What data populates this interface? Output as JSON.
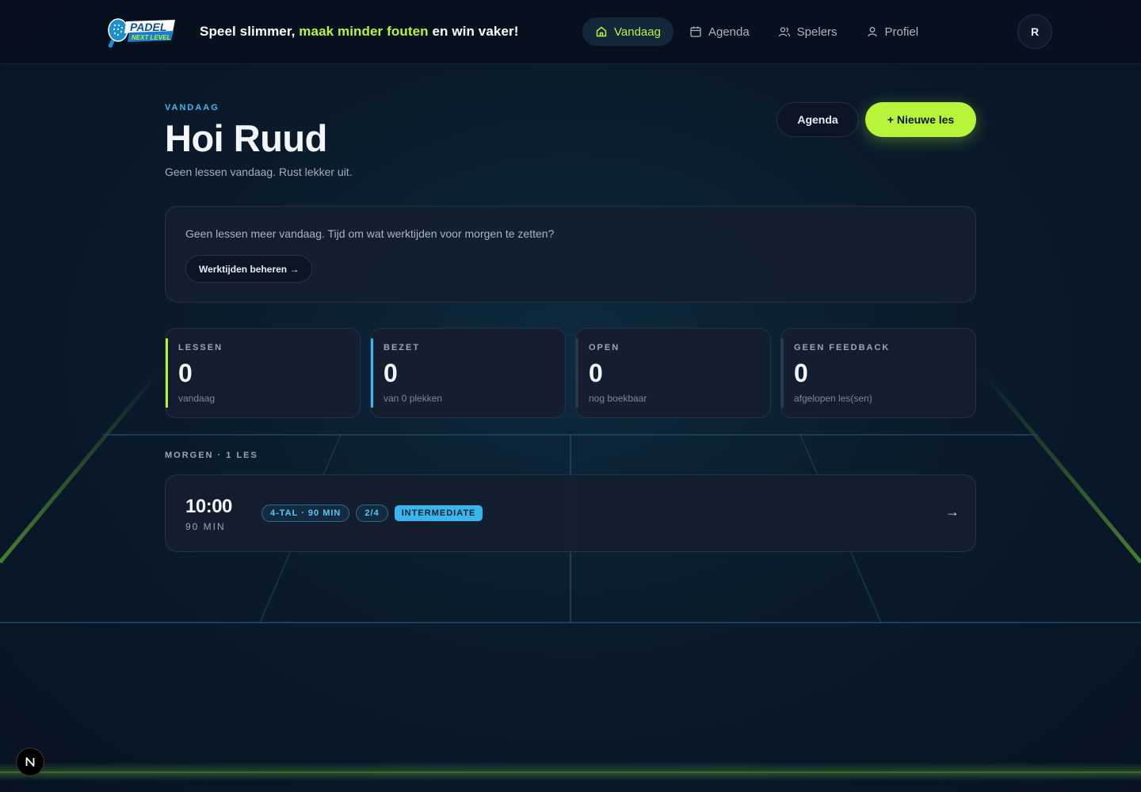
{
  "header": {
    "logo_text": "PADEL NEXT LEVEL",
    "tagline_start": "Speel slimmer,",
    "tagline_accent": "maak minder fouten",
    "tagline_end": "en win vaker!",
    "nav": [
      {
        "label": "Vandaag",
        "icon": "home-icon",
        "active": true
      },
      {
        "label": "Agenda",
        "icon": "calendar-icon",
        "active": false
      },
      {
        "label": "Spelers",
        "icon": "users-icon",
        "active": false
      },
      {
        "label": "Profiel",
        "icon": "user-icon",
        "active": false
      }
    ],
    "avatar_initial": "R"
  },
  "hero": {
    "eyebrow": "VANDAAG",
    "greeting": "Hoi Ruud",
    "subtitle": "Geen lessen vandaag. Rust lekker uit.",
    "agenda_button": "Agenda",
    "new_lesson_button": "+ Nieuwe les"
  },
  "notice": {
    "text": "Geen lessen meer vandaag. Tijd om wat werktijden voor morgen te zetten?",
    "button": "Werktijden beheren →"
  },
  "stats": [
    {
      "label": "LESSEN",
      "value": "0",
      "sub": "vandaag",
      "accent": "#b8f53a"
    },
    {
      "label": "BEZET",
      "value": "0",
      "sub": "van 0 plekken",
      "accent": "#39b6ee"
    },
    {
      "label": "OPEN",
      "value": "0",
      "sub": "nog boekbaar",
      "accent": "#2a3a52"
    },
    {
      "label": "GEEN FEEDBACK",
      "value": "0",
      "sub": "afgelopen les(sen)",
      "accent": "#2a3a52"
    }
  ],
  "tomorrow": {
    "section_label": "MORGEN · 1 LES",
    "lessons": [
      {
        "time": "10:00",
        "duration": "90 MIN",
        "chips": [
          "4-TAL · 90 MIN",
          "2/4"
        ],
        "level": "INTERMEDIATE",
        "arrow": "→"
      }
    ]
  },
  "fab": {
    "label": "N"
  },
  "colors": {
    "accent_lime": "#b8f53a",
    "accent_blue": "#39b6ee",
    "background": "#0a1b2c"
  }
}
